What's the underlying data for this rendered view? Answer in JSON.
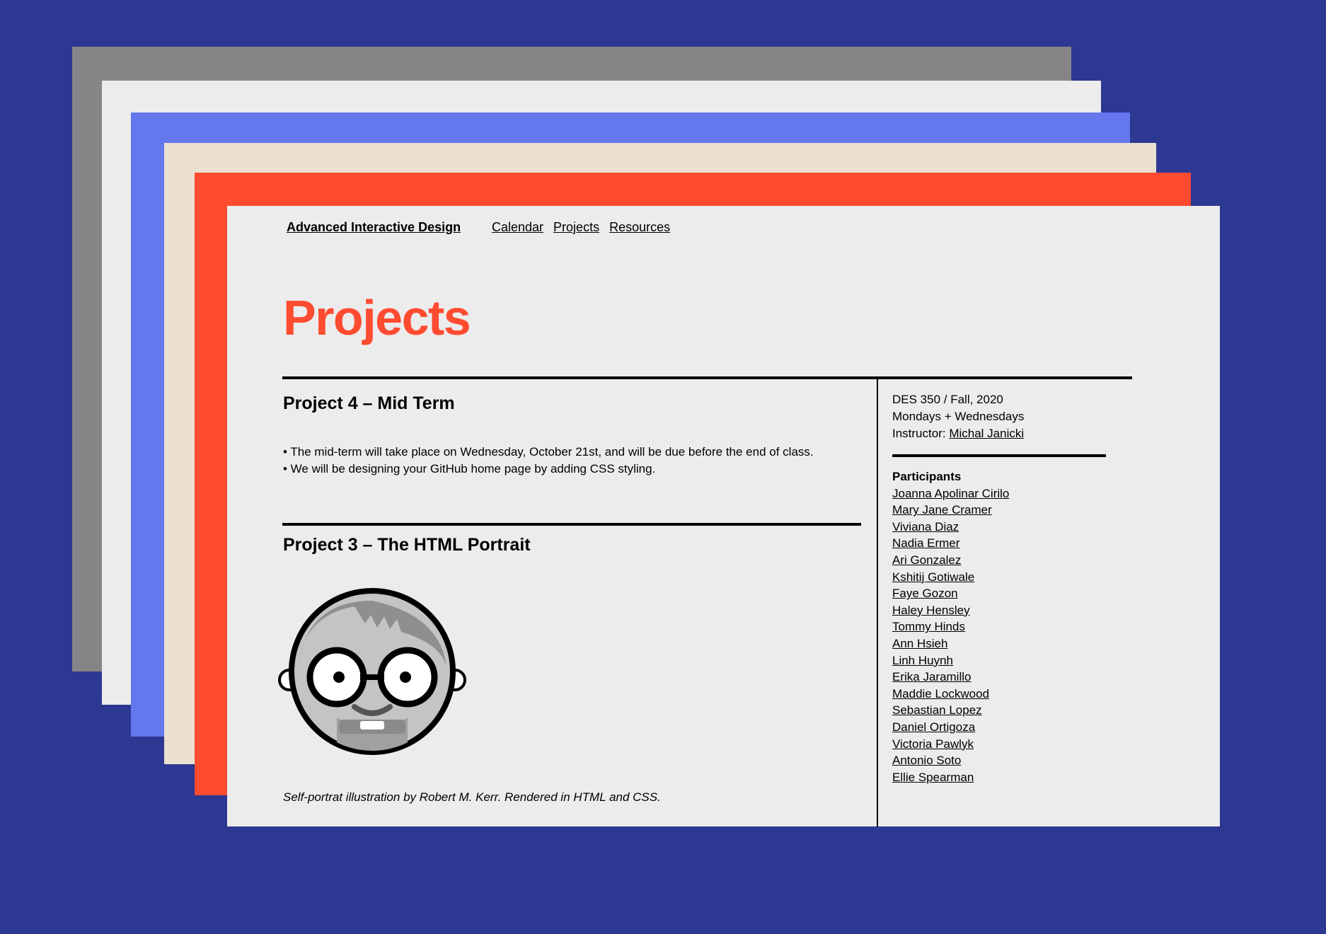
{
  "colors": {
    "background": "#2c3892",
    "accent": "#ff4b30",
    "page": "#ececec",
    "stack": [
      "#868486",
      "#ececec",
      "#6477ec",
      "#ece0d0",
      "#ff4b30"
    ]
  },
  "header": {
    "site_title": "Advanced Interactive Design",
    "nav": [
      "Calendar",
      "Projects",
      "Resources"
    ]
  },
  "main": {
    "page_title": "Projects",
    "project4": {
      "heading": "Project 4 – Mid Term",
      "bullets": [
        "• The mid-term will take place on Wednesday, October 21st, and will be due before the end of class.",
        "• We will be designing your GitHub home page by adding CSS styling."
      ]
    },
    "project3": {
      "heading": "Project 3 – The HTML Portrait",
      "portrait_icon": "face-portrait-icon",
      "caption": "Self-portrat illustration by Robert M. Kerr. Rendered in HTML and CSS."
    }
  },
  "sidebar": {
    "course": "DES 350 / Fall, 2020",
    "schedule": "Mondays + Wednesdays",
    "instructor_label": "Instructor: ",
    "instructor_name": "Michal Janicki",
    "participants_label": "Participants",
    "participants": [
      "Joanna Apolinar Cirilo",
      "Mary Jane Cramer",
      "Viviana Diaz",
      "Nadia Ermer",
      "Ari Gonzalez",
      "Kshitij Gotiwale",
      "Faye Gozon",
      "Haley Hensley",
      "Tommy Hinds",
      "Ann Hsieh",
      "Linh Huynh",
      "Erika Jaramillo",
      "Maddie Lockwood",
      "Sebastian Lopez",
      "Daniel Ortigoza",
      "Victoria Pawlyk",
      "Antonio Soto",
      "Ellie Spearman"
    ]
  }
}
